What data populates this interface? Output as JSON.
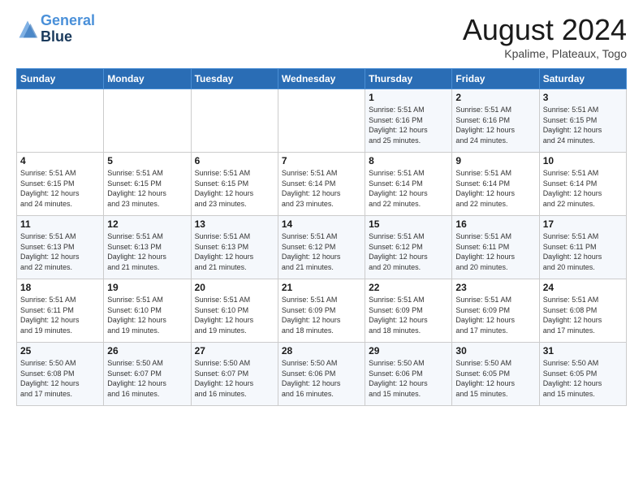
{
  "header": {
    "logo_line1": "General",
    "logo_line2": "Blue",
    "month_title": "August 2024",
    "location": "Kpalime, Plateaux, Togo"
  },
  "weekdays": [
    "Sunday",
    "Monday",
    "Tuesday",
    "Wednesday",
    "Thursday",
    "Friday",
    "Saturday"
  ],
  "weeks": [
    [
      {
        "day": "",
        "info": ""
      },
      {
        "day": "",
        "info": ""
      },
      {
        "day": "",
        "info": ""
      },
      {
        "day": "",
        "info": ""
      },
      {
        "day": "1",
        "info": "Sunrise: 5:51 AM\nSunset: 6:16 PM\nDaylight: 12 hours\nand 25 minutes."
      },
      {
        "day": "2",
        "info": "Sunrise: 5:51 AM\nSunset: 6:16 PM\nDaylight: 12 hours\nand 24 minutes."
      },
      {
        "day": "3",
        "info": "Sunrise: 5:51 AM\nSunset: 6:15 PM\nDaylight: 12 hours\nand 24 minutes."
      }
    ],
    [
      {
        "day": "4",
        "info": "Sunrise: 5:51 AM\nSunset: 6:15 PM\nDaylight: 12 hours\nand 24 minutes."
      },
      {
        "day": "5",
        "info": "Sunrise: 5:51 AM\nSunset: 6:15 PM\nDaylight: 12 hours\nand 23 minutes."
      },
      {
        "day": "6",
        "info": "Sunrise: 5:51 AM\nSunset: 6:15 PM\nDaylight: 12 hours\nand 23 minutes."
      },
      {
        "day": "7",
        "info": "Sunrise: 5:51 AM\nSunset: 6:14 PM\nDaylight: 12 hours\nand 23 minutes."
      },
      {
        "day": "8",
        "info": "Sunrise: 5:51 AM\nSunset: 6:14 PM\nDaylight: 12 hours\nand 22 minutes."
      },
      {
        "day": "9",
        "info": "Sunrise: 5:51 AM\nSunset: 6:14 PM\nDaylight: 12 hours\nand 22 minutes."
      },
      {
        "day": "10",
        "info": "Sunrise: 5:51 AM\nSunset: 6:14 PM\nDaylight: 12 hours\nand 22 minutes."
      }
    ],
    [
      {
        "day": "11",
        "info": "Sunrise: 5:51 AM\nSunset: 6:13 PM\nDaylight: 12 hours\nand 22 minutes."
      },
      {
        "day": "12",
        "info": "Sunrise: 5:51 AM\nSunset: 6:13 PM\nDaylight: 12 hours\nand 21 minutes."
      },
      {
        "day": "13",
        "info": "Sunrise: 5:51 AM\nSunset: 6:13 PM\nDaylight: 12 hours\nand 21 minutes."
      },
      {
        "day": "14",
        "info": "Sunrise: 5:51 AM\nSunset: 6:12 PM\nDaylight: 12 hours\nand 21 minutes."
      },
      {
        "day": "15",
        "info": "Sunrise: 5:51 AM\nSunset: 6:12 PM\nDaylight: 12 hours\nand 20 minutes."
      },
      {
        "day": "16",
        "info": "Sunrise: 5:51 AM\nSunset: 6:11 PM\nDaylight: 12 hours\nand 20 minutes."
      },
      {
        "day": "17",
        "info": "Sunrise: 5:51 AM\nSunset: 6:11 PM\nDaylight: 12 hours\nand 20 minutes."
      }
    ],
    [
      {
        "day": "18",
        "info": "Sunrise: 5:51 AM\nSunset: 6:11 PM\nDaylight: 12 hours\nand 19 minutes."
      },
      {
        "day": "19",
        "info": "Sunrise: 5:51 AM\nSunset: 6:10 PM\nDaylight: 12 hours\nand 19 minutes."
      },
      {
        "day": "20",
        "info": "Sunrise: 5:51 AM\nSunset: 6:10 PM\nDaylight: 12 hours\nand 19 minutes."
      },
      {
        "day": "21",
        "info": "Sunrise: 5:51 AM\nSunset: 6:09 PM\nDaylight: 12 hours\nand 18 minutes."
      },
      {
        "day": "22",
        "info": "Sunrise: 5:51 AM\nSunset: 6:09 PM\nDaylight: 12 hours\nand 18 minutes."
      },
      {
        "day": "23",
        "info": "Sunrise: 5:51 AM\nSunset: 6:09 PM\nDaylight: 12 hours\nand 17 minutes."
      },
      {
        "day": "24",
        "info": "Sunrise: 5:51 AM\nSunset: 6:08 PM\nDaylight: 12 hours\nand 17 minutes."
      }
    ],
    [
      {
        "day": "25",
        "info": "Sunrise: 5:50 AM\nSunset: 6:08 PM\nDaylight: 12 hours\nand 17 minutes."
      },
      {
        "day": "26",
        "info": "Sunrise: 5:50 AM\nSunset: 6:07 PM\nDaylight: 12 hours\nand 16 minutes."
      },
      {
        "day": "27",
        "info": "Sunrise: 5:50 AM\nSunset: 6:07 PM\nDaylight: 12 hours\nand 16 minutes."
      },
      {
        "day": "28",
        "info": "Sunrise: 5:50 AM\nSunset: 6:06 PM\nDaylight: 12 hours\nand 16 minutes."
      },
      {
        "day": "29",
        "info": "Sunrise: 5:50 AM\nSunset: 6:06 PM\nDaylight: 12 hours\nand 15 minutes."
      },
      {
        "day": "30",
        "info": "Sunrise: 5:50 AM\nSunset: 6:05 PM\nDaylight: 12 hours\nand 15 minutes."
      },
      {
        "day": "31",
        "info": "Sunrise: 5:50 AM\nSunset: 6:05 PM\nDaylight: 12 hours\nand 15 minutes."
      }
    ]
  ]
}
